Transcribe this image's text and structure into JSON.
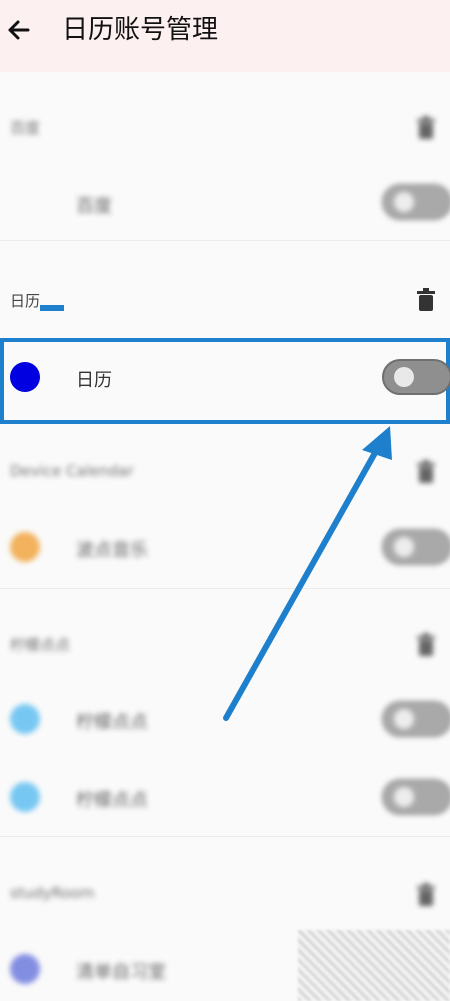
{
  "header": {
    "title": "日历账号管理"
  },
  "sections": [
    {
      "label": "百度",
      "rows": [
        {
          "label": "百度"
        }
      ]
    },
    {
      "label": "日历",
      "rows": [
        {
          "label": "日历"
        }
      ]
    },
    {
      "label": "Device Calendar",
      "rows": [
        {
          "label": "波点音乐"
        }
      ]
    },
    {
      "label": "柠檬点点",
      "rows": [
        {
          "label": "柠檬点点"
        },
        {
          "label": "柠檬点点"
        }
      ]
    },
    {
      "label": "studyRoom",
      "rows": [
        {
          "label": "清单自习室"
        }
      ]
    }
  ],
  "colors": {
    "header_bg": "#fdf0f1",
    "highlight": "#1e80cc",
    "dot_calendar": "#0000e0",
    "dot_music": "#f09a2a",
    "dot_lemon": "#4bb7ef",
    "dot_study": "#5b6ad9",
    "toggle_off": "#8f8f8f"
  }
}
